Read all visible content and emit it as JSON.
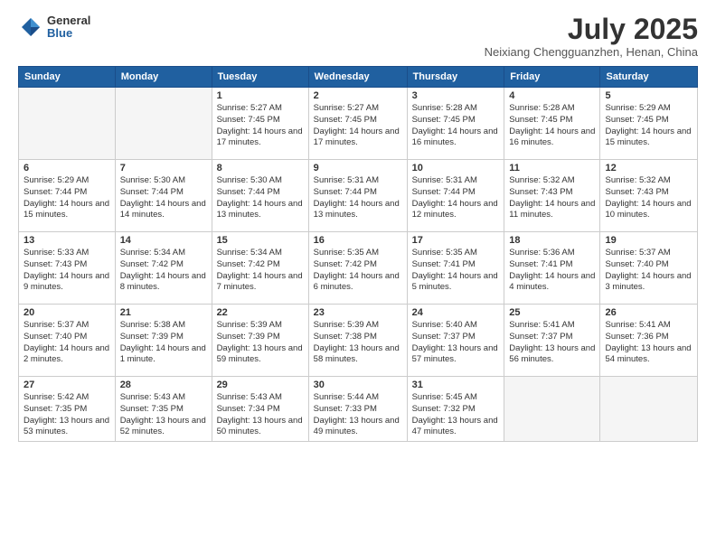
{
  "header": {
    "logo": {
      "general": "General",
      "blue": "Blue"
    },
    "title": "July 2025",
    "location": "Neixiang Chengguanzhen, Henan, China"
  },
  "weekdays": [
    "Sunday",
    "Monday",
    "Tuesday",
    "Wednesday",
    "Thursday",
    "Friday",
    "Saturday"
  ],
  "weeks": [
    [
      {
        "day": "",
        "info": ""
      },
      {
        "day": "",
        "info": ""
      },
      {
        "day": "1",
        "info": "Sunrise: 5:27 AM\nSunset: 7:45 PM\nDaylight: 14 hours and 17 minutes."
      },
      {
        "day": "2",
        "info": "Sunrise: 5:27 AM\nSunset: 7:45 PM\nDaylight: 14 hours and 17 minutes."
      },
      {
        "day": "3",
        "info": "Sunrise: 5:28 AM\nSunset: 7:45 PM\nDaylight: 14 hours and 16 minutes."
      },
      {
        "day": "4",
        "info": "Sunrise: 5:28 AM\nSunset: 7:45 PM\nDaylight: 14 hours and 16 minutes."
      },
      {
        "day": "5",
        "info": "Sunrise: 5:29 AM\nSunset: 7:45 PM\nDaylight: 14 hours and 15 minutes."
      }
    ],
    [
      {
        "day": "6",
        "info": "Sunrise: 5:29 AM\nSunset: 7:44 PM\nDaylight: 14 hours and 15 minutes."
      },
      {
        "day": "7",
        "info": "Sunrise: 5:30 AM\nSunset: 7:44 PM\nDaylight: 14 hours and 14 minutes."
      },
      {
        "day": "8",
        "info": "Sunrise: 5:30 AM\nSunset: 7:44 PM\nDaylight: 14 hours and 13 minutes."
      },
      {
        "day": "9",
        "info": "Sunrise: 5:31 AM\nSunset: 7:44 PM\nDaylight: 14 hours and 13 minutes."
      },
      {
        "day": "10",
        "info": "Sunrise: 5:31 AM\nSunset: 7:44 PM\nDaylight: 14 hours and 12 minutes."
      },
      {
        "day": "11",
        "info": "Sunrise: 5:32 AM\nSunset: 7:43 PM\nDaylight: 14 hours and 11 minutes."
      },
      {
        "day": "12",
        "info": "Sunrise: 5:32 AM\nSunset: 7:43 PM\nDaylight: 14 hours and 10 minutes."
      }
    ],
    [
      {
        "day": "13",
        "info": "Sunrise: 5:33 AM\nSunset: 7:43 PM\nDaylight: 14 hours and 9 minutes."
      },
      {
        "day": "14",
        "info": "Sunrise: 5:34 AM\nSunset: 7:42 PM\nDaylight: 14 hours and 8 minutes."
      },
      {
        "day": "15",
        "info": "Sunrise: 5:34 AM\nSunset: 7:42 PM\nDaylight: 14 hours and 7 minutes."
      },
      {
        "day": "16",
        "info": "Sunrise: 5:35 AM\nSunset: 7:42 PM\nDaylight: 14 hours and 6 minutes."
      },
      {
        "day": "17",
        "info": "Sunrise: 5:35 AM\nSunset: 7:41 PM\nDaylight: 14 hours and 5 minutes."
      },
      {
        "day": "18",
        "info": "Sunrise: 5:36 AM\nSunset: 7:41 PM\nDaylight: 14 hours and 4 minutes."
      },
      {
        "day": "19",
        "info": "Sunrise: 5:37 AM\nSunset: 7:40 PM\nDaylight: 14 hours and 3 minutes."
      }
    ],
    [
      {
        "day": "20",
        "info": "Sunrise: 5:37 AM\nSunset: 7:40 PM\nDaylight: 14 hours and 2 minutes."
      },
      {
        "day": "21",
        "info": "Sunrise: 5:38 AM\nSunset: 7:39 PM\nDaylight: 14 hours and 1 minute."
      },
      {
        "day": "22",
        "info": "Sunrise: 5:39 AM\nSunset: 7:39 PM\nDaylight: 13 hours and 59 minutes."
      },
      {
        "day": "23",
        "info": "Sunrise: 5:39 AM\nSunset: 7:38 PM\nDaylight: 13 hours and 58 minutes."
      },
      {
        "day": "24",
        "info": "Sunrise: 5:40 AM\nSunset: 7:37 PM\nDaylight: 13 hours and 57 minutes."
      },
      {
        "day": "25",
        "info": "Sunrise: 5:41 AM\nSunset: 7:37 PM\nDaylight: 13 hours and 56 minutes."
      },
      {
        "day": "26",
        "info": "Sunrise: 5:41 AM\nSunset: 7:36 PM\nDaylight: 13 hours and 54 minutes."
      }
    ],
    [
      {
        "day": "27",
        "info": "Sunrise: 5:42 AM\nSunset: 7:35 PM\nDaylight: 13 hours and 53 minutes."
      },
      {
        "day": "28",
        "info": "Sunrise: 5:43 AM\nSunset: 7:35 PM\nDaylight: 13 hours and 52 minutes."
      },
      {
        "day": "29",
        "info": "Sunrise: 5:43 AM\nSunset: 7:34 PM\nDaylight: 13 hours and 50 minutes."
      },
      {
        "day": "30",
        "info": "Sunrise: 5:44 AM\nSunset: 7:33 PM\nDaylight: 13 hours and 49 minutes."
      },
      {
        "day": "31",
        "info": "Sunrise: 5:45 AM\nSunset: 7:32 PM\nDaylight: 13 hours and 47 minutes."
      },
      {
        "day": "",
        "info": ""
      },
      {
        "day": "",
        "info": ""
      }
    ]
  ]
}
